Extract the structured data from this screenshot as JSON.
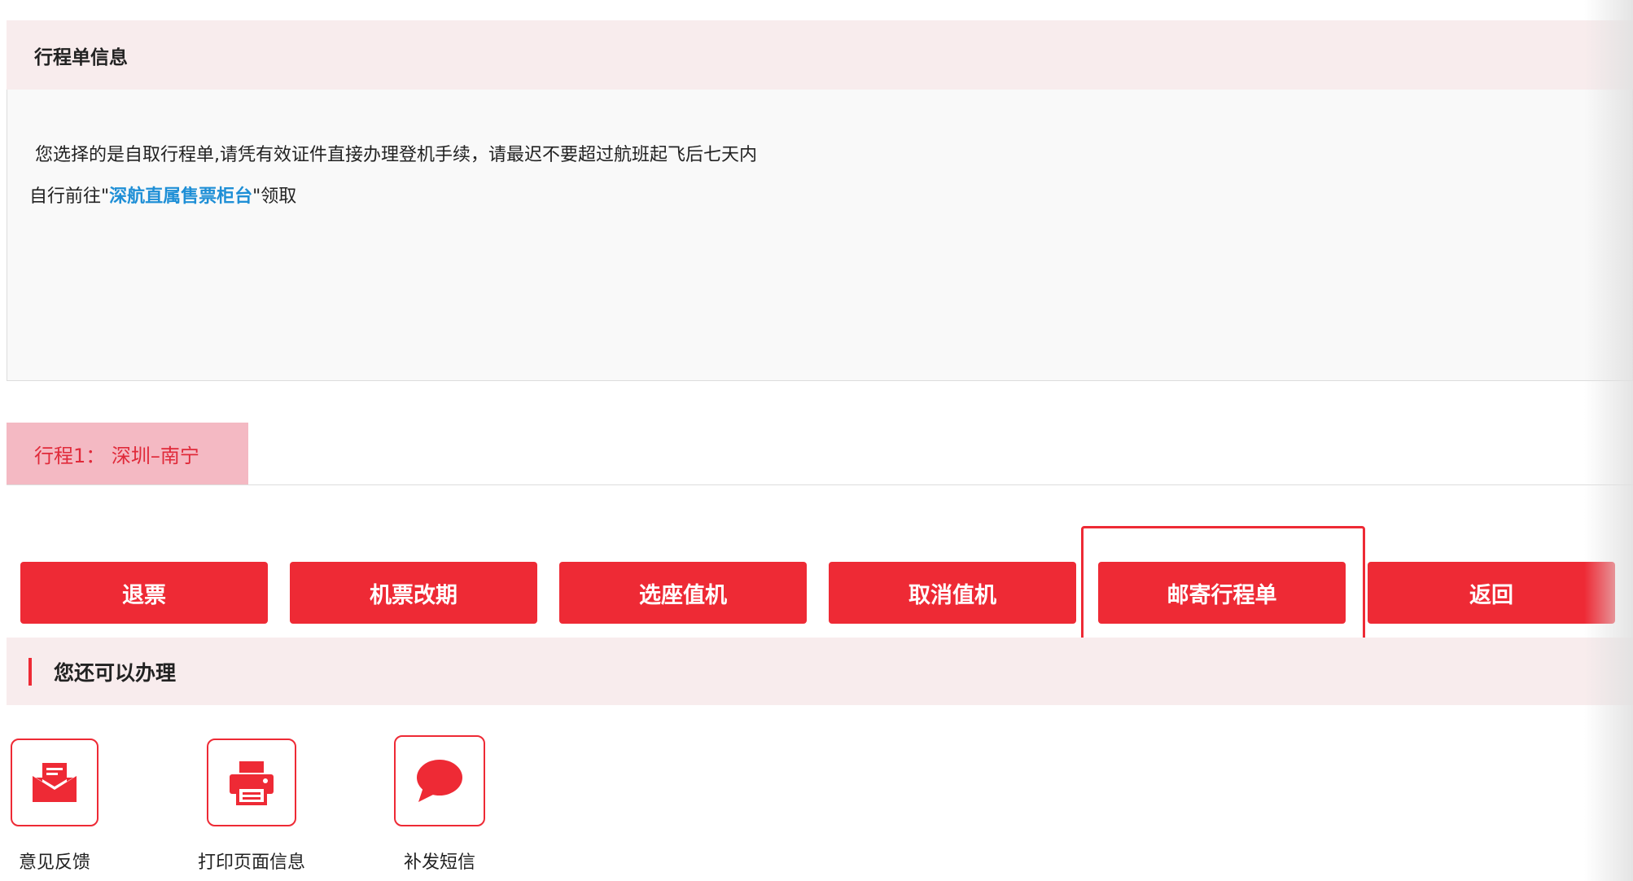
{
  "itinerary_info": {
    "title": "行程单信息",
    "line1": "您选择的是自取行程单,请凭有效证件直接办理登机手续，请最迟不要超过航班起飞后七天内",
    "line2_prefix": "自行前往\"",
    "line2_link": "深航直属售票柜台",
    "line2_suffix": "\"领取"
  },
  "trip_tab": {
    "label": "行程1： 深圳–南宁"
  },
  "actions": {
    "refund": "退票",
    "change": "机票改期",
    "seat_checkin": "选座值机",
    "cancel_checkin": "取消值机",
    "mail_itinerary": "邮寄行程单",
    "back": "返回"
  },
  "more_services": {
    "title": "您还可以办理",
    "items": [
      {
        "label": "意见反馈",
        "icon": "mail-feedback-icon"
      },
      {
        "label": "打印页面信息",
        "icon": "printer-icon"
      },
      {
        "label": "补发短信",
        "icon": "chat-bubble-icon"
      }
    ]
  },
  "colors": {
    "accent_red": "#ee2a35",
    "tab_pink": "#f4b9c3",
    "header_pink": "#f8eced",
    "link_blue": "#1f8fd6"
  }
}
